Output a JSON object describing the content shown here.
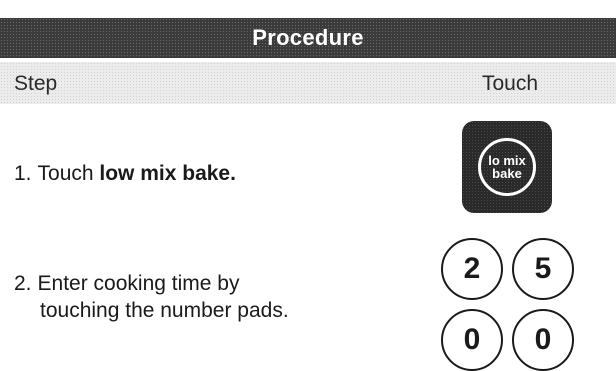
{
  "header": {
    "title": "Procedure"
  },
  "columns": {
    "step": "Step",
    "touch": "Touch"
  },
  "steps": [
    {
      "number": "1.",
      "text_prefix": "Touch ",
      "text_bold": "low mix bake.",
      "key": {
        "line1": "lo mix",
        "line2": "bake",
        "icon": "lo-mix-bake-key"
      }
    },
    {
      "number": "2.",
      "line1": "Enter cooking time by",
      "line2": "touching the number pads.",
      "keys": [
        "2",
        "5",
        "0",
        "0"
      ]
    }
  ],
  "colors": {
    "header_bg": "#3a3a3a",
    "subheader_bg": "#ececec",
    "key_dark": "#2a2a2a",
    "text": "#1a1a1a"
  }
}
